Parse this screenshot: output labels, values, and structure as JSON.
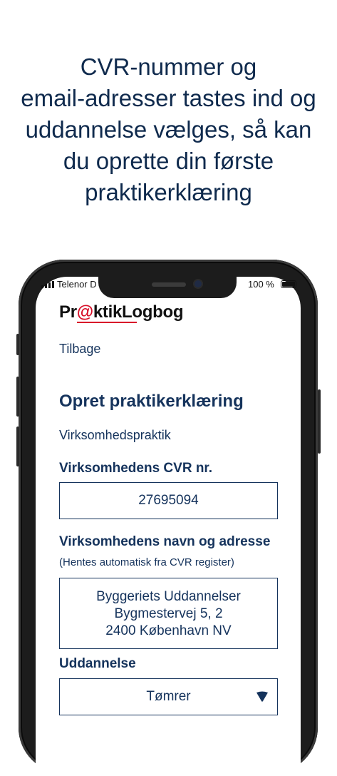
{
  "headline": "CVR-nummer og\nemail-adresser tastes ind og\nuddannelse vælges, så kan\ndu oprette din første\npraktikerklæring",
  "status_bar": {
    "carrier": "Telenor D",
    "battery": "100 %"
  },
  "app": {
    "logo_prefix": "Pr",
    "logo_at": "@",
    "logo_suffix": "ktikLogbog",
    "back_label": "Tilbage",
    "page_title": "Opret praktikerklæring",
    "subtitle": "Virksomhedspraktik",
    "cvr_label": "Virksomhedens CVR nr.",
    "cvr_value": "27695094",
    "address_label": "Virksomhedens navn og adresse",
    "address_hint": "(Hentes automatisk fra CVR register)",
    "address_lines": [
      "Byggeriets Uddannelser",
      "Bygmestervej 5, 2",
      "2400 København NV"
    ],
    "education_label": "Uddannelse",
    "education_value": "Tømrer"
  },
  "colors": {
    "primary": "#15335c",
    "logo_accent": "#d8102a",
    "headline": "#0f2a4d"
  }
}
